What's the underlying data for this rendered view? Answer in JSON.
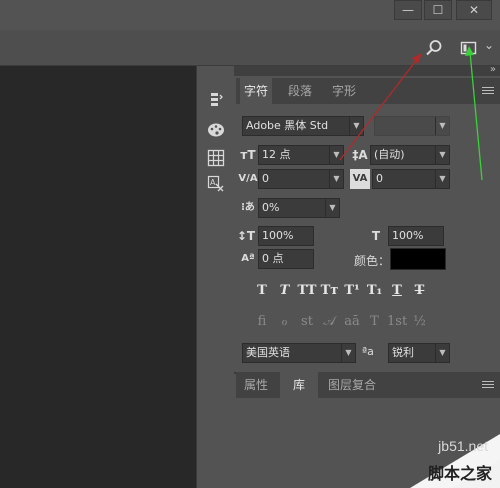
{
  "window": {
    "minimize_glyph": "—",
    "maximize_glyph": "☐",
    "close_glyph": "✕"
  },
  "options_bar": {
    "search_icon": "search-icon",
    "workspace_icon": "workspace-icon",
    "dropdown_glyph": "⌄"
  },
  "panel_collapse": {
    "left": "«",
    "right": "»"
  },
  "character_panel": {
    "tabs": [
      "字符",
      "段落",
      "字形"
    ],
    "active_tab": "字符",
    "font_family": "Adobe 黑体 Std",
    "font_style": "",
    "font_size": "12 点",
    "leading": "(自动)",
    "kerning": "0",
    "tracking": "0",
    "tsume": "0%",
    "vertical_scale": "100%",
    "horizontal_scale": "100%",
    "baseline_shift": "0 点",
    "color_label": "颜色：",
    "color_value": "#000000",
    "language": "美国英语",
    "aa_icon_text": "ªa",
    "antialias": "锐利",
    "style_buttons": [
      "T",
      "T",
      "TT",
      "Tт",
      "T¹",
      "T₁",
      "T",
      "T"
    ],
    "opentype_buttons": [
      "ﬁ",
      "ℴ",
      "st",
      "𝒜",
      "aā",
      "T",
      "1st",
      "½"
    ]
  },
  "bottom_panel": {
    "tabs": [
      "属性",
      "库",
      "图层复合"
    ],
    "active_tab": "库"
  },
  "watermark": {
    "line1": "jb51.net",
    "line2": "脚本之家"
  }
}
